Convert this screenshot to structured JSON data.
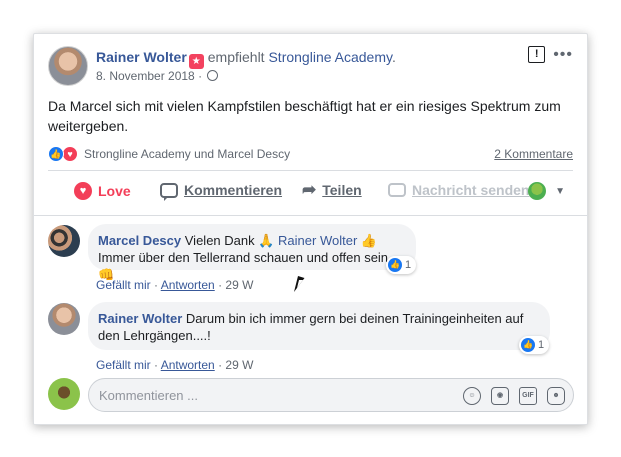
{
  "post": {
    "author": "Rainer Wolter",
    "recommends_text": "empfiehlt",
    "page_name": "Strongline Academy",
    "page_suffix": ".",
    "date": "8. November 2018",
    "date_separator": "·",
    "body": "Da Marcel sich mit vielen Kampfstilen beschäftigt hat er ein riesiges Spektrum zum weitergeben.",
    "reaction_names": "Strongline Academy und Marcel Descy",
    "comments_count": "2 Kommentare"
  },
  "actions": {
    "love": "Love",
    "comment": "Kommentieren",
    "share": "Teilen",
    "message": "Nachricht senden"
  },
  "comments": [
    {
      "author": "Marcel Descy",
      "text_before": "Vielen Dank 🙏",
      "mention": "Rainer Wolter",
      "text_after": "👍",
      "line2": "Immer über den Tellerrand schauen und offen sein 👊",
      "like": "Gefällt mir",
      "reply": "Antworten",
      "time": "29 W",
      "reaction_count": "1"
    },
    {
      "author": "Rainer Wolter",
      "text": "Darum bin ich immer gern bei deinen Trainingeinheiten auf den Lehrgängen....!",
      "like": "Gefällt mir",
      "reply": "Antworten",
      "time": "29 W",
      "reaction_count": "1"
    }
  ],
  "composer": {
    "placeholder": "Kommentieren ..."
  },
  "icons": {
    "badge": "recommend-badge-icon",
    "globe": "globe-icon",
    "flag": "report-flag-icon",
    "more": "more-options-icon",
    "like": "like-reaction-icon",
    "love": "love-reaction-icon",
    "share": "share-arrow-icon",
    "message": "message-bubble-icon",
    "emoji": "emoji-icon",
    "camera": "camera-icon",
    "gif": "gif-icon",
    "sticker": "sticker-icon"
  },
  "colors": {
    "link": "#385898",
    "love": "#f33e58",
    "like": "#1877f2",
    "muted": "#606770"
  }
}
